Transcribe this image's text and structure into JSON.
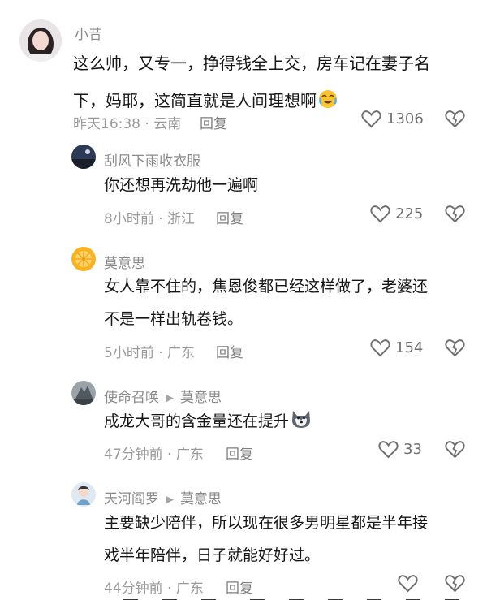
{
  "comments": [
    {
      "name": "小昔",
      "text_lines": [
        "这么帅，又专一，挣得钱全上交，房车记在妻子名",
        "下，妈耶，这简直就是人间理想啊"
      ],
      "emoji": "laughing-crying-emoji",
      "time_location": "昨天16:38 · 云南",
      "reply_label": "回复",
      "likes": "1306"
    },
    {
      "name": "刮风下雨收衣服",
      "text_lines": [
        "你还想再洗劫他一遍啊"
      ],
      "time_location": "8小时前 · 浙江",
      "reply_label": "回复",
      "likes": "225"
    },
    {
      "name": "莫意思",
      "text_lines": [
        "女人靠不住的，焦恩俊都已经这样做了，老婆还",
        "不是一样出轨卷钱。"
      ],
      "time_location": "5小时前 · 广东",
      "reply_label": "回复",
      "likes": "154"
    },
    {
      "name": "使命召唤",
      "reply_to": "莫意思",
      "text_lines": [
        "成龙大哥的含金量还在提升"
      ],
      "emoji": "husky-emoji",
      "time_location": "47分钟前 · 广东",
      "reply_label": "回复",
      "likes": "33"
    },
    {
      "name": "天河阎罗",
      "reply_to": "莫意思",
      "text_lines": [
        "主要缺少陪伴，所以现在很多男明星都是半年接",
        "戏半年陪伴，日子就能好好过。"
      ],
      "time_location": "44分钟前 · 广东",
      "reply_label": "回复",
      "likes": ""
    }
  ],
  "colors": {
    "name": "#8a8a8a",
    "text": "#151515",
    "meta": "#9a9a9a",
    "icon": "#6f6f6f"
  }
}
